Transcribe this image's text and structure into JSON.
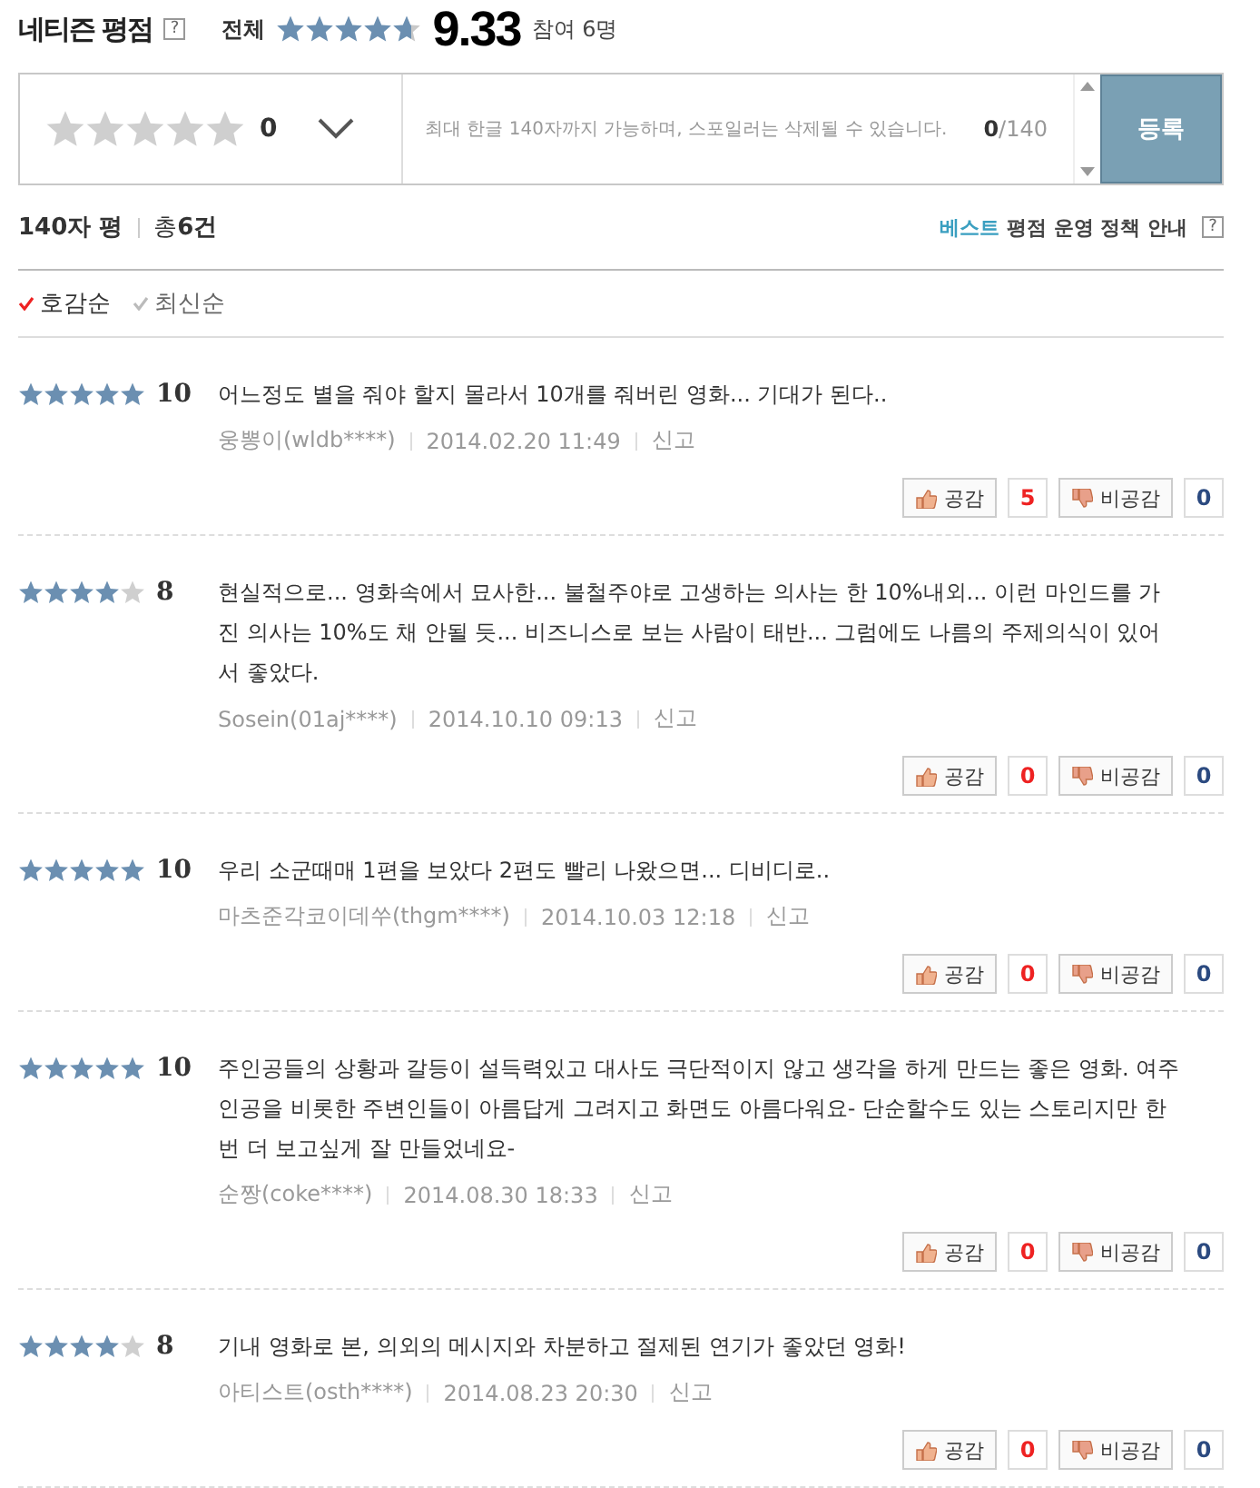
{
  "header": {
    "title": "네티즌 평점",
    "help": "?",
    "scope": "전체",
    "stars": 4.67,
    "score": "9.33",
    "participants": "참여 6명"
  },
  "compose": {
    "stars": 0,
    "score": "0",
    "placeholder": "최대 한글 140자까지 가능하며, 스포일러는 삭제될 수 있습니다.",
    "count": "0",
    "limit": "/140",
    "submit": "등록"
  },
  "summary": {
    "label": "140자 평",
    "total_prefix": "총",
    "total": "6건",
    "policy_highlight": "베스트",
    "policy": "평점 운영 정책 안내",
    "help": "?"
  },
  "sort": [
    {
      "label": "호감순",
      "selected": true
    },
    {
      "label": "최신순",
      "selected": false
    }
  ],
  "reviews": [
    {
      "stars": 5,
      "score": "10",
      "text": "어느정도 별을 줘야 할지 몰라서 10개를 줘버린 영화... 기대가 된다..",
      "author": "웅뽕이(wldb****)",
      "date": "2014.02.20 11:49",
      "report": "신고",
      "like": "공감",
      "likes": "5",
      "dislike": "비공감",
      "dislikes": "0"
    },
    {
      "stars": 4,
      "score": "8",
      "text": "현실적으로... 영화속에서 묘사한... 불철주야로 고생하는 의사는 한 10%내외... 이런 마인드를 가진 의사는 10%도 채 안될 듯... 비즈니스로 보는 사람이 태반... 그럼에도 나름의 주제의식이 있어서 좋았다.",
      "author": "Sosein(01aj****)",
      "date": "2014.10.10 09:13",
      "report": "신고",
      "like": "공감",
      "likes": "0",
      "dislike": "비공감",
      "dislikes": "0"
    },
    {
      "stars": 5,
      "score": "10",
      "text": "우리 소군때매 1편을 보았다 2편도 빨리 나왔으면... 디비디로..",
      "author": "마츠준각코이데쑤(thgm****)",
      "date": "2014.10.03 12:18",
      "report": "신고",
      "like": "공감",
      "likes": "0",
      "dislike": "비공감",
      "dislikes": "0"
    },
    {
      "stars": 5,
      "score": "10",
      "text": "주인공들의 상황과 갈등이 설득력있고 대사도 극단적이지 않고 생각을 하게 만드는 좋은 영화. 여주인공을 비롯한 주변인들이 아름답게 그려지고 화면도 아름다워요- 단순할수도 있는 스토리지만 한번 더 보고싶게 잘 만들었네요-",
      "author": "순짱(coke****)",
      "date": "2014.08.30 18:33",
      "report": "신고",
      "like": "공감",
      "likes": "0",
      "dislike": "비공감",
      "dislikes": "0"
    },
    {
      "stars": 4,
      "score": "8",
      "text": "기내 영화로 본, 의외의 메시지와 차분하고 절제된 연기가 좋았던 영화!",
      "author": "아티스트(osth****)",
      "date": "2014.08.23 20:30",
      "report": "신고",
      "like": "공감",
      "likes": "0",
      "dislike": "비공감",
      "dislikes": "0"
    }
  ]
}
